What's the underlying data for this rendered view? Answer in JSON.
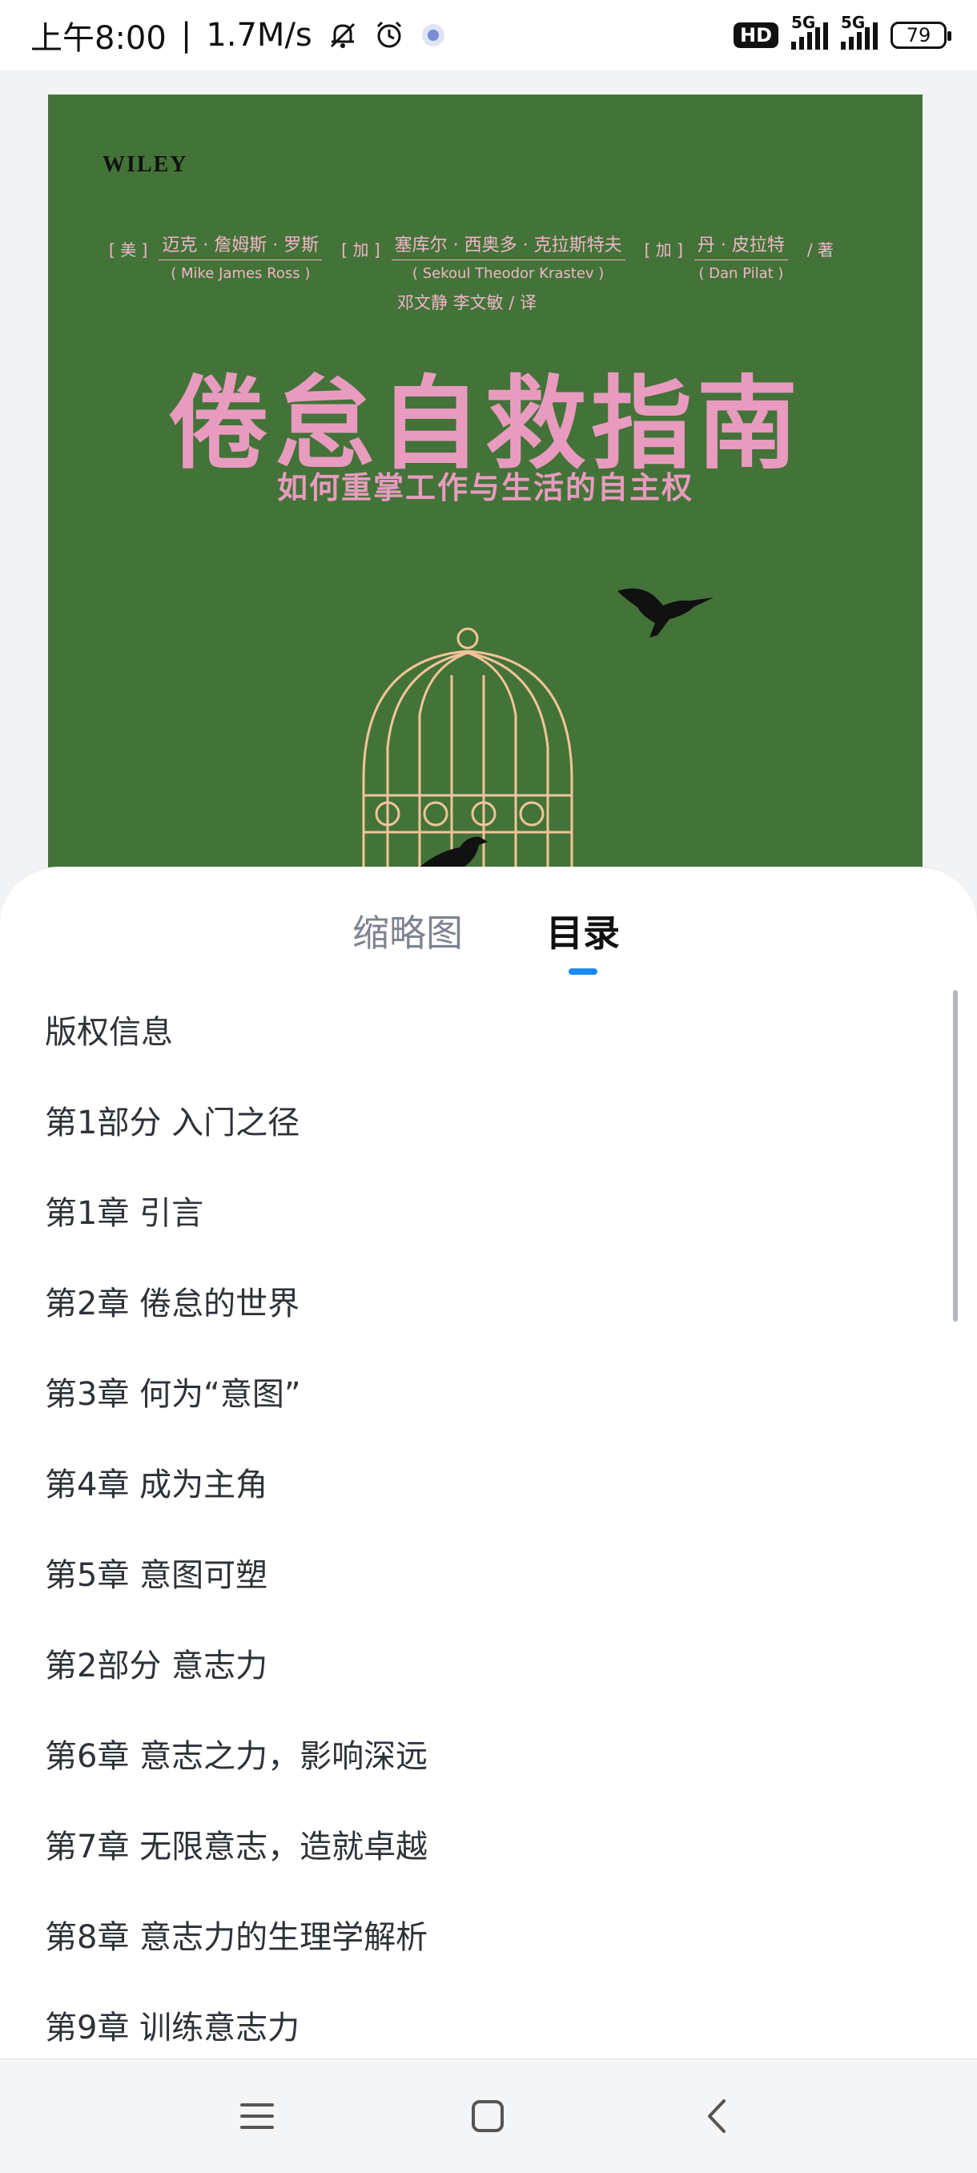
{
  "status_bar": {
    "time": "上午8:00",
    "speed": "1.7M/s",
    "hd_badge": "HD",
    "network1": "5G",
    "network2": "5G",
    "battery": "79"
  },
  "cover": {
    "publisher": "WILEY",
    "authors": [
      {
        "nationality": "[ 美 ]",
        "name_cn": "迈克 · 詹姆斯 · 罗斯",
        "name_en": "( Mike James Ross )"
      },
      {
        "nationality": "[ 加 ]",
        "name_cn": "塞库尔 · 西奥多 · 克拉斯特夫",
        "name_en": "( Sekoul Theodor Krastev )"
      },
      {
        "nationality": "[ 加 ]",
        "name_cn": "丹 · 皮拉特",
        "name_en": "( Dan Pilat )"
      }
    ],
    "author_role": "/ 著",
    "translators": "邓文静    李文敏 / 译",
    "title": "倦怠自救指南",
    "subtitle": "如何重掌工作与生活的自主权",
    "colors": {
      "background": "#437338",
      "title": "#e89bbf",
      "cage": "#f2c49b"
    }
  },
  "sheet": {
    "tabs": [
      {
        "label": "缩略图",
        "selected": false
      },
      {
        "label": "目录",
        "selected": true
      }
    ],
    "toc_items": [
      "版权信息",
      "第1部分 入门之径",
      "第1章 引言",
      "第2章 倦怠的世界",
      "第3章 何为“意图”",
      "第4章 成为主角",
      "第5章 意图可塑",
      "第2部分 意志力",
      "第6章 意志之力，影响深远",
      "第7章 无限意志，造就卓越",
      "第8章 意志力的生理学解析",
      "第9章 训练意志力"
    ],
    "accent_color": "#1a8cf0"
  },
  "nav_bar": {
    "icons": [
      "menu-icon",
      "home-icon",
      "back-icon"
    ]
  }
}
